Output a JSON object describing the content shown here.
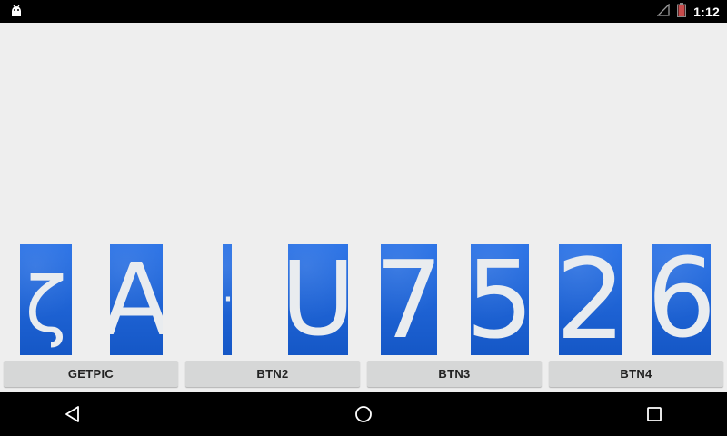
{
  "status_bar": {
    "time": "1:12",
    "icons": [
      "android-icon",
      "signal-icon",
      "battery-icon"
    ]
  },
  "tiles": [
    {
      "glyph": "ζ"
    },
    {
      "glyph": "A"
    },
    {
      "glyph": "·"
    },
    {
      "glyph": "U"
    },
    {
      "glyph": "7"
    },
    {
      "glyph": "5"
    },
    {
      "glyph": "2"
    },
    {
      "glyph": "6"
    }
  ],
  "buttons": {
    "getpic": "GETPIC",
    "btn2": "BTN2",
    "btn3": "BTN3",
    "btn4": "BTN4"
  },
  "nav": {
    "icons": [
      "back-icon",
      "home-icon",
      "recents-icon"
    ]
  },
  "colors": {
    "plate_blue": "#1e64d6",
    "glyph_white": "#e9ecef",
    "button_bg": "#d6d7d7",
    "background": "#eeeeee"
  }
}
